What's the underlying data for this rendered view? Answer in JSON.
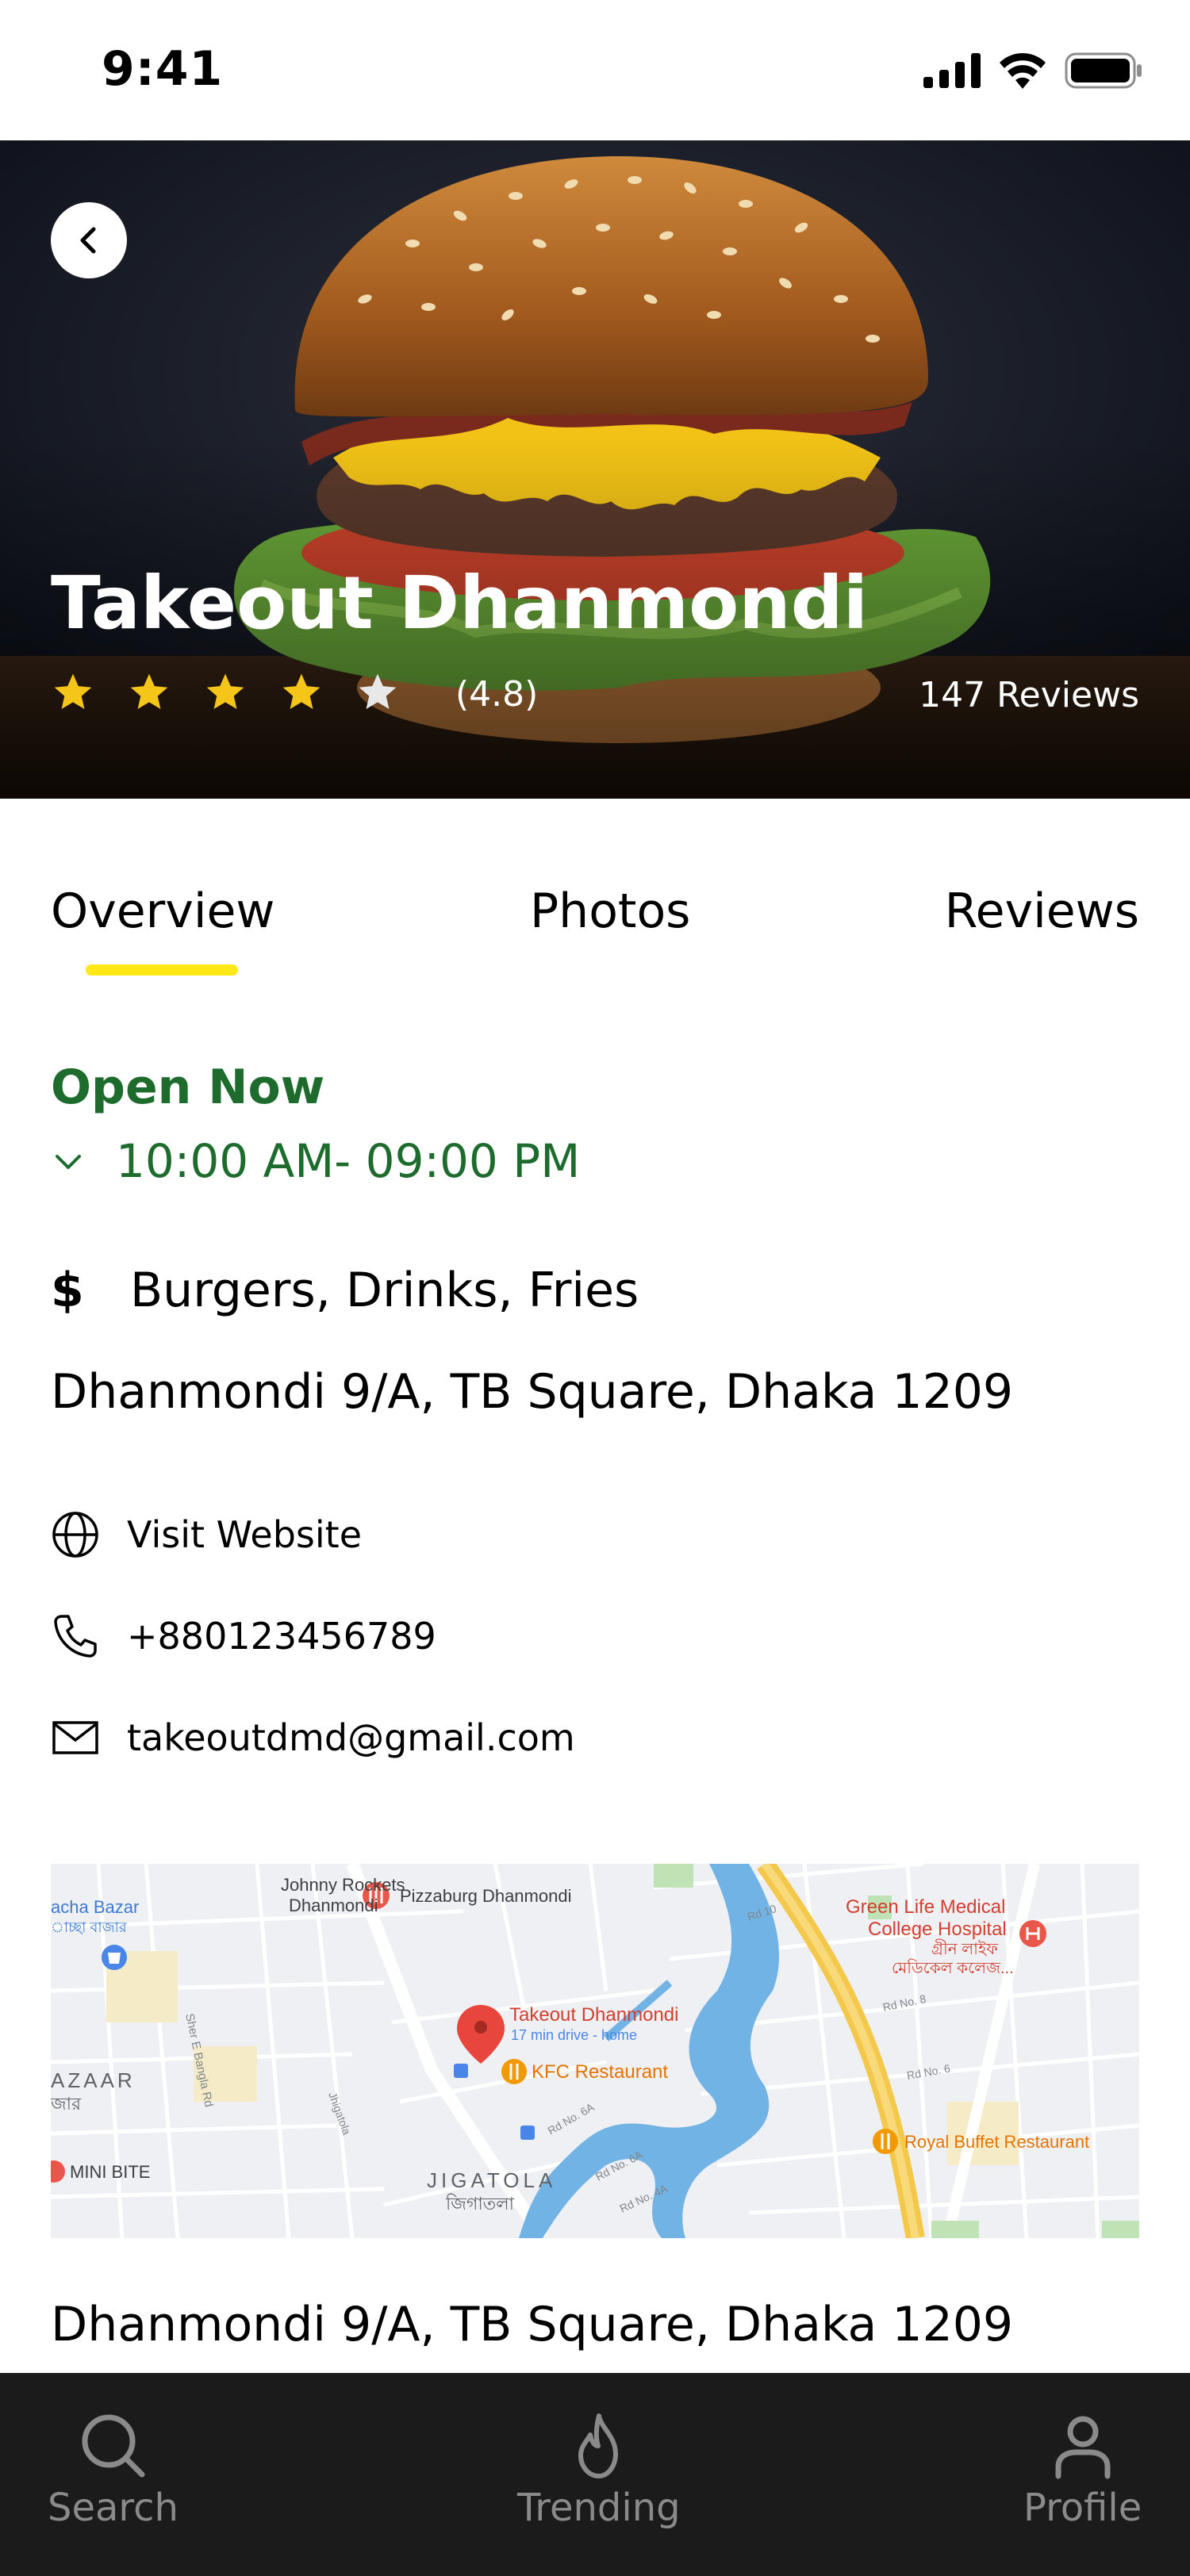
{
  "status_bar": {
    "time": "9:41"
  },
  "restaurant": {
    "name": "Takeout Dhanmondi",
    "rating_label": "(4.8)",
    "rating_value": 4.8,
    "stars_filled": 4,
    "stars_total": 5,
    "reviews_label": "147 Reviews"
  },
  "tabs": [
    {
      "label": "Overview",
      "active": true
    },
    {
      "label": "Photos",
      "active": false
    },
    {
      "label": "Reviews",
      "active": false
    }
  ],
  "overview": {
    "status": "Open Now",
    "hours": "10:00 AM- 09:00 PM",
    "price_symbol": "$",
    "cuisine": "Burgers, Drinks, Fries",
    "address": "Dhanmondi 9/A, TB Square, Dhaka 1209",
    "website_label": "Visit Website",
    "phone": "+880123456789",
    "email": "takeoutdmd@gmail.com",
    "address_bottom": "Dhanmondi 9/A, TB Square, Dhaka 1209"
  },
  "map": {
    "labels": {
      "johnny_rockets": "Johnny Rockets",
      "johnny_rockets_area": "Dhanmondi",
      "pizzaburg": "Pizzaburg Dhanmondi",
      "acha_bazar": "acha Bazar",
      "acha_bazar_bn": "াচ্ছা বাজার",
      "green_life_1": "Green Life Medical",
      "green_life_2": "College Hospital",
      "green_life_bn_1": "গ্রীন লাইফ",
      "green_life_bn_2": "মেডিকেল কলেজ...",
      "pin_title": "Takeout Dhanmondi",
      "pin_sub": "17 min drive - home",
      "kfc": "KFC Restaurant",
      "azaar": "AZAAR",
      "azaar_bn": "জার",
      "mini_bite": "MINI BITE",
      "jigatola": "JIGATOLA",
      "jigatola_bn": "জিগাতলা",
      "royal_buffet": "Royal Buffet Restaurant",
      "rd_10": "Rd 10",
      "rd_8": "Rd No. 8",
      "rd_6": "Rd No. 6",
      "rd_6a_1": "Rd No. 6A",
      "rd_6a_2": "Rd No. 6A",
      "rd_4a": "Rd No. 4A",
      "sher_e_bangla": "Sher E Bangla Rd",
      "jhigatola": "Jhigatola"
    }
  },
  "nav": {
    "search": "Search",
    "trending": "Trending",
    "profile": "Profile"
  },
  "colors": {
    "open_green": "#1E6B2E",
    "tab_underline": "#FFE815",
    "star_yellow": "#F5C518",
    "nav_bg": "#1B1B1B",
    "nav_text": "#8A8A8A"
  }
}
